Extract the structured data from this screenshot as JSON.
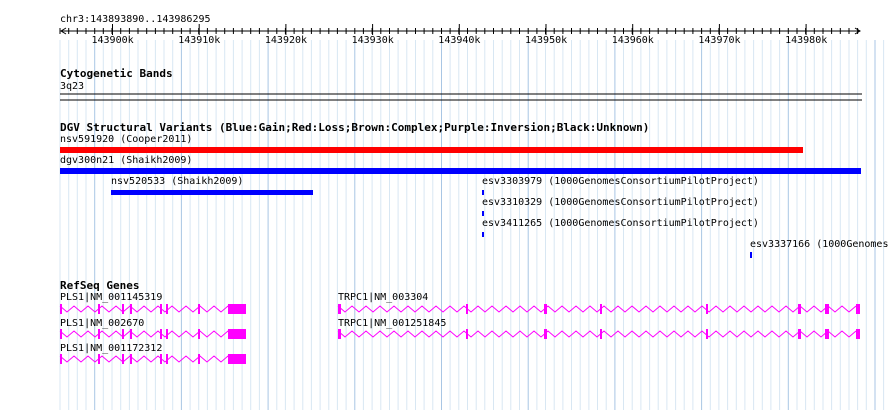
{
  "ruler": {
    "location": "chr3:143893890..143986295",
    "ticks": [
      "143900k",
      "143910k",
      "143920k",
      "143930k",
      "143940k",
      "143950k",
      "143960k",
      "143970k",
      "143980k"
    ]
  },
  "tracks": {
    "cytoband": {
      "title": "Cytogenetic Bands",
      "band": "3q23"
    },
    "dgv": {
      "title": "DGV Structural Variants (Blue:Gain;Red:Loss;Brown:Complex;Purple:Inversion;Black:Unknown)",
      "features": [
        {
          "label": "nsv591920 (Cooper2011)",
          "color": "#ff0000"
        },
        {
          "label": "dgv300n21 (Shaikh2009)",
          "color": "#0000ff"
        },
        {
          "label": "nsv520533 (Shaikh2009)",
          "color": "#0000ff"
        },
        {
          "label": "esv3303979 (1000GenomesConsortiumPilotProject)",
          "color": "#0000ff"
        },
        {
          "label": "esv3310329 (1000GenomesConsortiumPilotProject)",
          "color": "#0000ff"
        },
        {
          "label": "esv3411265 (1000GenomesConsortiumPilotProject)",
          "color": "#0000ff"
        },
        {
          "label": "esv3337166 (1000Genomes(",
          "color": "#0000ff"
        }
      ]
    },
    "refseq": {
      "title": "RefSeq Genes",
      "color": "#ff00ff",
      "genes": [
        {
          "label": "PLS1|NM_001145319"
        },
        {
          "label": "PLS1|NM_002670"
        },
        {
          "label": "PLS1|NM_001172312"
        },
        {
          "label": "TRPC1|NM_003304"
        },
        {
          "label": "TRPC1|NM_001251845"
        }
      ]
    }
  }
}
